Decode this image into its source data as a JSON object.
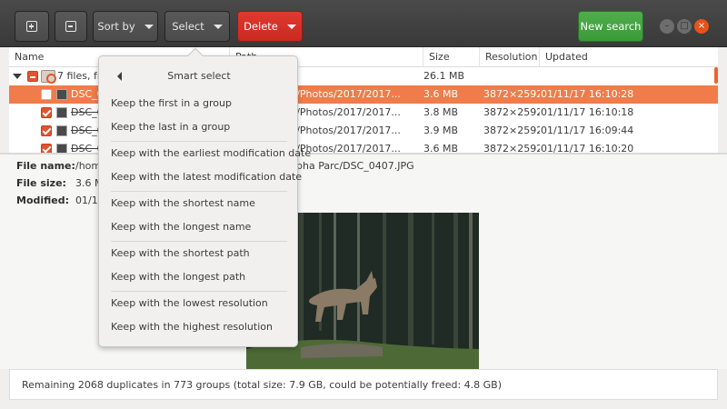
{
  "header": {
    "add_label": "",
    "remove_label": "",
    "sort_label": "Sort by",
    "select_label": "Select",
    "delete_label": "Delete",
    "new_search_label": "New search",
    "minimize_glyph": "–",
    "maximize_glyph": "□",
    "close_glyph": "×"
  },
  "columns": {
    "name": "Name",
    "path": "Path",
    "size": "Size",
    "resolution": "Resolution",
    "updated": "Updated"
  },
  "group_row": {
    "name": "7 files, fro",
    "size": "26.1 MB"
  },
  "rows": [
    {
      "name": "DSC_0",
      "path": "sions/Photos/2017/2017...",
      "size": "3.6 MB",
      "resolution": "3872×2592",
      "updated": "01/11/17 16:10:28"
    },
    {
      "name": "DSC_0",
      "path": "sions/Photos/2017/2017...",
      "size": "3.8 MB",
      "resolution": "3872×2592",
      "updated": "01/11/17 16:10:18"
    },
    {
      "name": "DSC_0",
      "path": "sions/Photos/2017/2017...",
      "size": "3.9 MB",
      "resolution": "3872×2592",
      "updated": "01/11/17 16:09:44"
    },
    {
      "name": "DSC_0",
      "path": "sions/Photos/2017/2017...",
      "size": "3.6 MB",
      "resolution": "3872×2592",
      "updated": "01/11/17 16:10:20"
    }
  ],
  "details": {
    "file_name_label": "File name:",
    "file_name_value": "/hom",
    "file_name_tail": "pha Parc/DSC_0407.JPG",
    "file_size_label": "File size:",
    "file_size_value": "3.6 M",
    "modified_label": "Modified:",
    "modified_value": "01/1"
  },
  "status": "Remaining 2068 duplicates in 773 groups (total size: 7.9 GB, could be potentially freed: 4.8 GB)",
  "popover": {
    "title": "Smart select",
    "items": [
      "Keep the first in a group",
      "Keep the last in a group",
      "Keep with the earliest modification date",
      "Keep with the latest modification date",
      "Keep with the shortest name",
      "Keep with the longest name",
      "Keep with the shortest path",
      "Keep with the longest path",
      "Keep with the lowest resolution",
      "Keep with the highest resolution"
    ]
  },
  "colors": {
    "selection": "#ef7c4a",
    "accent": "#e2542d",
    "delete": "#d9342a",
    "new_search": "#45a541"
  }
}
